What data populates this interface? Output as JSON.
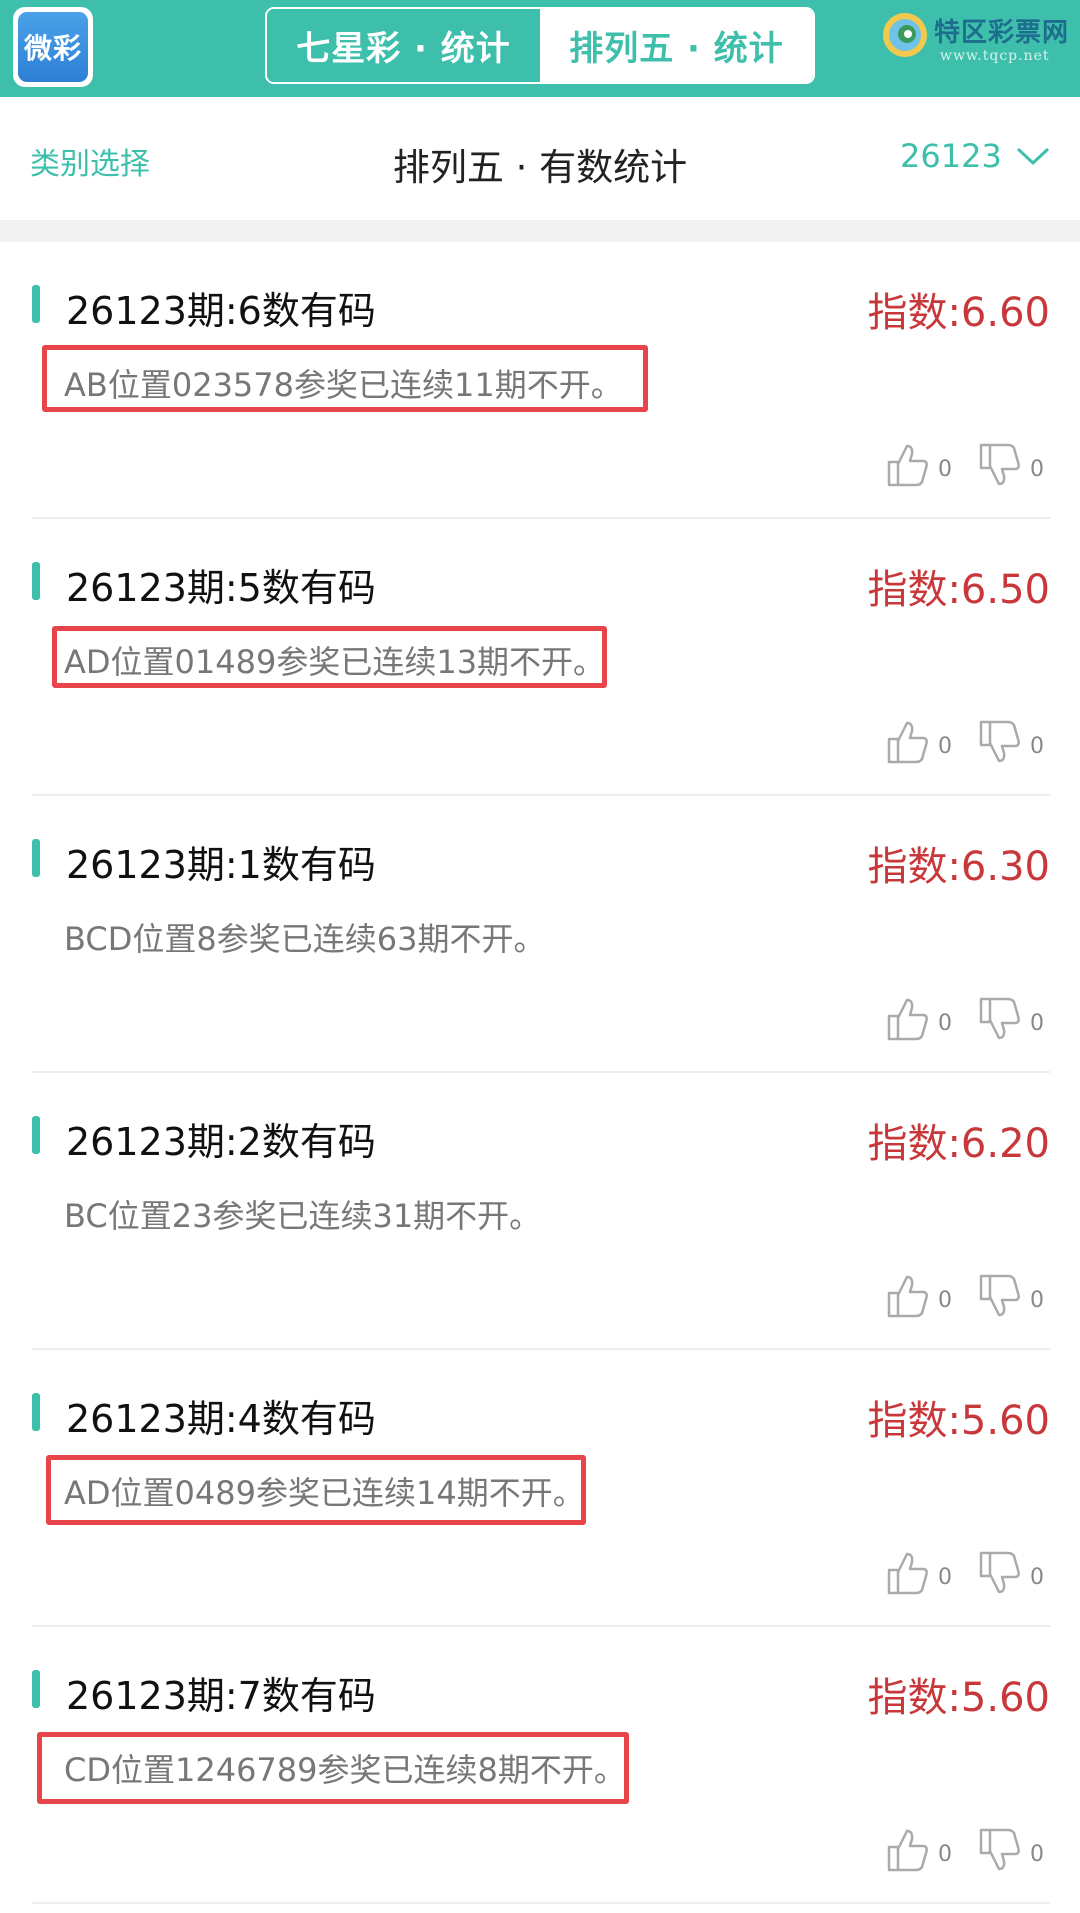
{
  "header": {
    "app_logo_text": "微彩",
    "tabs": [
      {
        "label": "七星彩 · 统计",
        "active": false
      },
      {
        "label": "排列五 · 统计",
        "active": true
      }
    ],
    "brand_name": "特区彩票网",
    "brand_url": "www.tqcp.net"
  },
  "subheader": {
    "category_label": "类别选择",
    "title": "排列五 · 有数统计",
    "issue": "26123"
  },
  "items": [
    {
      "title": "26123期:6数有码",
      "score": "指数:6.60",
      "desc": "AB位置023578参奖已连续11期不开。",
      "likes": "0",
      "dislikes": "0",
      "highlighted": true
    },
    {
      "title": "26123期:5数有码",
      "score": "指数:6.50",
      "desc": "AD位置01489参奖已连续13期不开。",
      "likes": "0",
      "dislikes": "0",
      "highlighted": true
    },
    {
      "title": "26123期:1数有码",
      "score": "指数:6.30",
      "desc": "BCD位置8参奖已连续63期不开。",
      "likes": "0",
      "dislikes": "0",
      "highlighted": false
    },
    {
      "title": "26123期:2数有码",
      "score": "指数:6.20",
      "desc": "BC位置23参奖已连续31期不开。",
      "likes": "0",
      "dislikes": "0",
      "highlighted": false
    },
    {
      "title": "26123期:4数有码",
      "score": "指数:5.60",
      "desc": "AD位置0489参奖已连续14期不开。",
      "likes": "0",
      "dislikes": "0",
      "highlighted": true
    },
    {
      "title": "26123期:7数有码",
      "score": "指数:5.60",
      "desc": "CD位置1246789参奖已连续8期不开。",
      "likes": "0",
      "dislikes": "0",
      "highlighted": true
    }
  ],
  "colors": {
    "accent": "#3dbfac",
    "score": "#c8383b",
    "highlight_border": "#e8444c"
  }
}
